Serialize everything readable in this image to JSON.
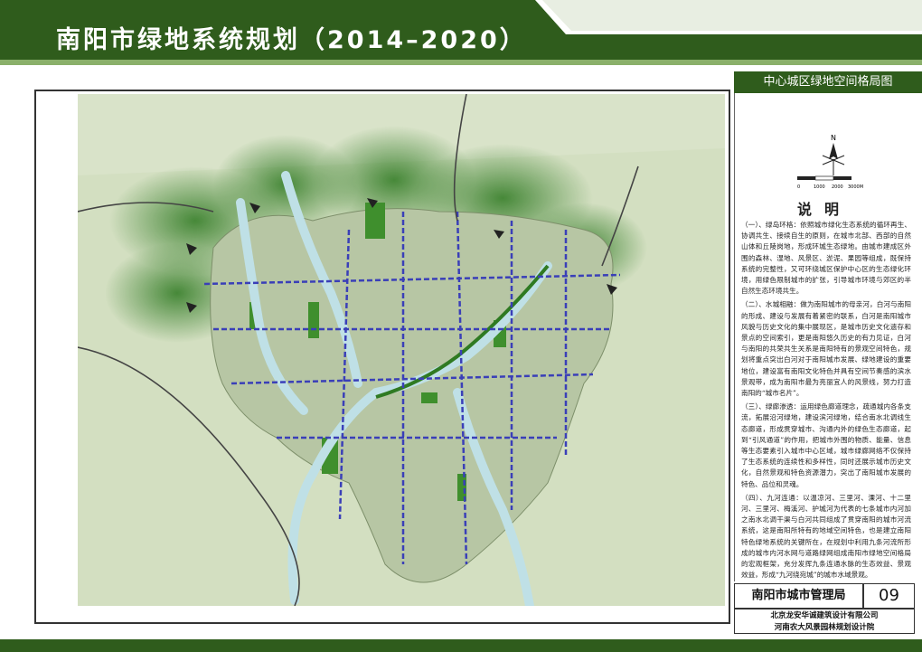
{
  "header": {
    "title": "南阳市绿地系统规划（2014–2020）",
    "map_name": "中心城区绿地空间格局图"
  },
  "colors": {
    "brand_green": "#2f5c1c",
    "light_green": "#8ab06a",
    "water": "#bfe0e6",
    "road_blue": "#3a3fb8"
  },
  "legend": {
    "title": "说明",
    "north_icon": "north-arrow-icon",
    "scale_labels": [
      "0",
      "1000",
      "2000",
      "3000M"
    ],
    "paragraphs": [
      "（一）、绿岛环格：依照城市绿化生态系统的循环再生、协调共生、接续自生的原则，在城市北部、西部的自然山体和丘陵岗地，形成环城生态绿地。由城市建成区外围的森林、湿地、风景区、淤泥、果园等组成，既保持系统的完整性，又可环绕城区保护中心区的生态绿化环境，用绿色限制城市的扩张，引导城市环境与郊区的半自然生态环境共生。",
      "（二）、水城相融：做为南阳城市的母亲河，白河与南阳的形成、建设与发展有着紧密的联系，白河是南阳城市风貌与历史文化的集中展现区，是城市历史文化遗存和景点的空间索引，更是南阳悠久历史的有力见证，白河与南阳的共荣共生关系是南阳特有的景观空间特色，规划将重点突出白河对于南阳城市发展、绿地建设的重要地位，建设富有南阳文化特色并具有空间节奏感的滨水景观带，成为南阳市最为亮丽宜人的风景线，努力打造南阳的“城市名片”。",
      "（三）、绿廊渗透：运用绿色廊道理念，疏通城内各条支流，拓展沿河绿地，建设滨河绿地，结合南水北调线生态廊道，形成贯穿城市、沟通内外的绿色生态廊道，起到“引风通道”的作用，把城市外围的物质、能量、信息等生态要素引入城市中心区域，城市绿廊网络不仅保持了生态系统的连续性和多样性，同时还展示城市历史文化，自然景观和特色资源潜力，突出了南阳城市发展的特色、品位和灵魂。",
      "（四）、九河连通：以温凉河、三里河、溧河、十二里河、三里河、梅溪河、护城河为代表的七条城市内河加之南水北调干渠与白河共同组成了贯穿南阳的城市河流系统，这是南阳所特有的地域空间特色，也是建立南阳特色绿地系统的关键所在，在规划中利用九条河流所形成的城市内河水网与道路绿网组成南阳市绿地空间格局的宏观框架，充分发挥九条连通水脉的生态效益、景观效益，形成“九河绕宛城”的城市水域景观。"
    ]
  },
  "footer": {
    "authority": "南阳市城市管理局",
    "page_number": "09",
    "designer_1": "北京龙安华诚建筑设计有限公司",
    "designer_2": "河南农大风景园林规划设计院"
  }
}
